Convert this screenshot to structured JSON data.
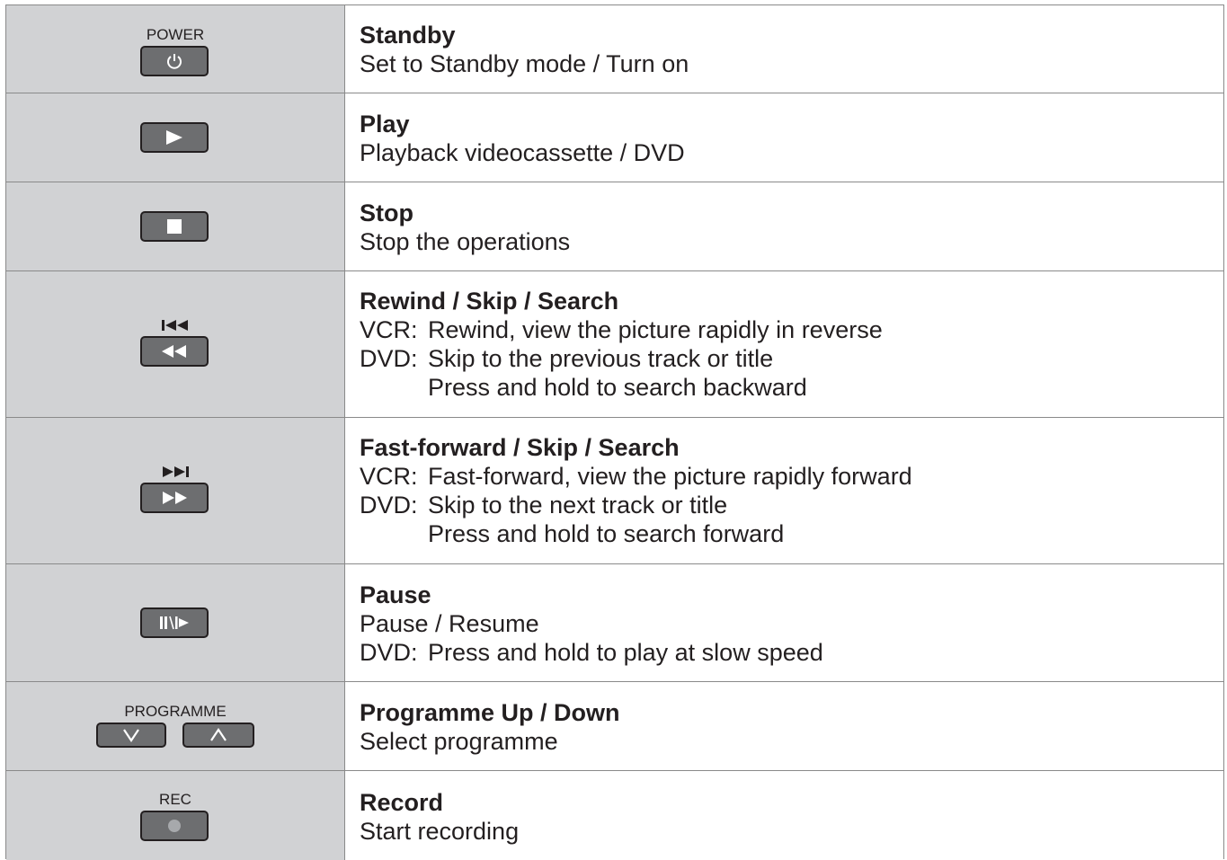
{
  "rows": [
    {
      "button_label": "POWER",
      "icon": "power-icon",
      "title": "Standby",
      "lines": [
        "Set to Standby mode / Turn on"
      ]
    },
    {
      "icon": "play-icon",
      "title": "Play",
      "lines": [
        "Playback videocassette / DVD"
      ]
    },
    {
      "icon": "stop-icon",
      "title": "Stop",
      "lines": [
        "Stop the operations"
      ]
    },
    {
      "icon": "rewind-icon",
      "top_icon": "skip-previous-icon",
      "title": "Rewind / Skip / Search",
      "vcr_prefix": "VCR:",
      "vcr_text": "Rewind, view the picture rapidly in reverse",
      "dvd_prefix": "DVD:",
      "dvd_text": "Skip to the previous track or title",
      "extra": "Press and hold to search backward"
    },
    {
      "icon": "fast-forward-icon",
      "top_icon": "skip-next-icon",
      "title": "Fast-forward / Skip / Search",
      "vcr_prefix": "VCR:",
      "vcr_text": "Fast-forward, view the picture rapidly forward",
      "dvd_prefix": "DVD:",
      "dvd_text": "Skip to the next track or title",
      "extra": "Press and hold to search forward"
    },
    {
      "icon": "pause-slow-icon",
      "title": "Pause",
      "lines": [
        "Pause / Resume"
      ],
      "dvd_prefix": "DVD:",
      "dvd_text": "Press and hold to play at slow speed"
    },
    {
      "button_label": "PROGRAMME",
      "icons": [
        "chevron-down-icon",
        "chevron-up-icon"
      ],
      "title": "Programme Up / Down",
      "lines": [
        "Select programme"
      ]
    },
    {
      "button_label": "REC",
      "icon": "record-icon",
      "title": "Record",
      "lines": [
        "Start recording"
      ]
    }
  ]
}
